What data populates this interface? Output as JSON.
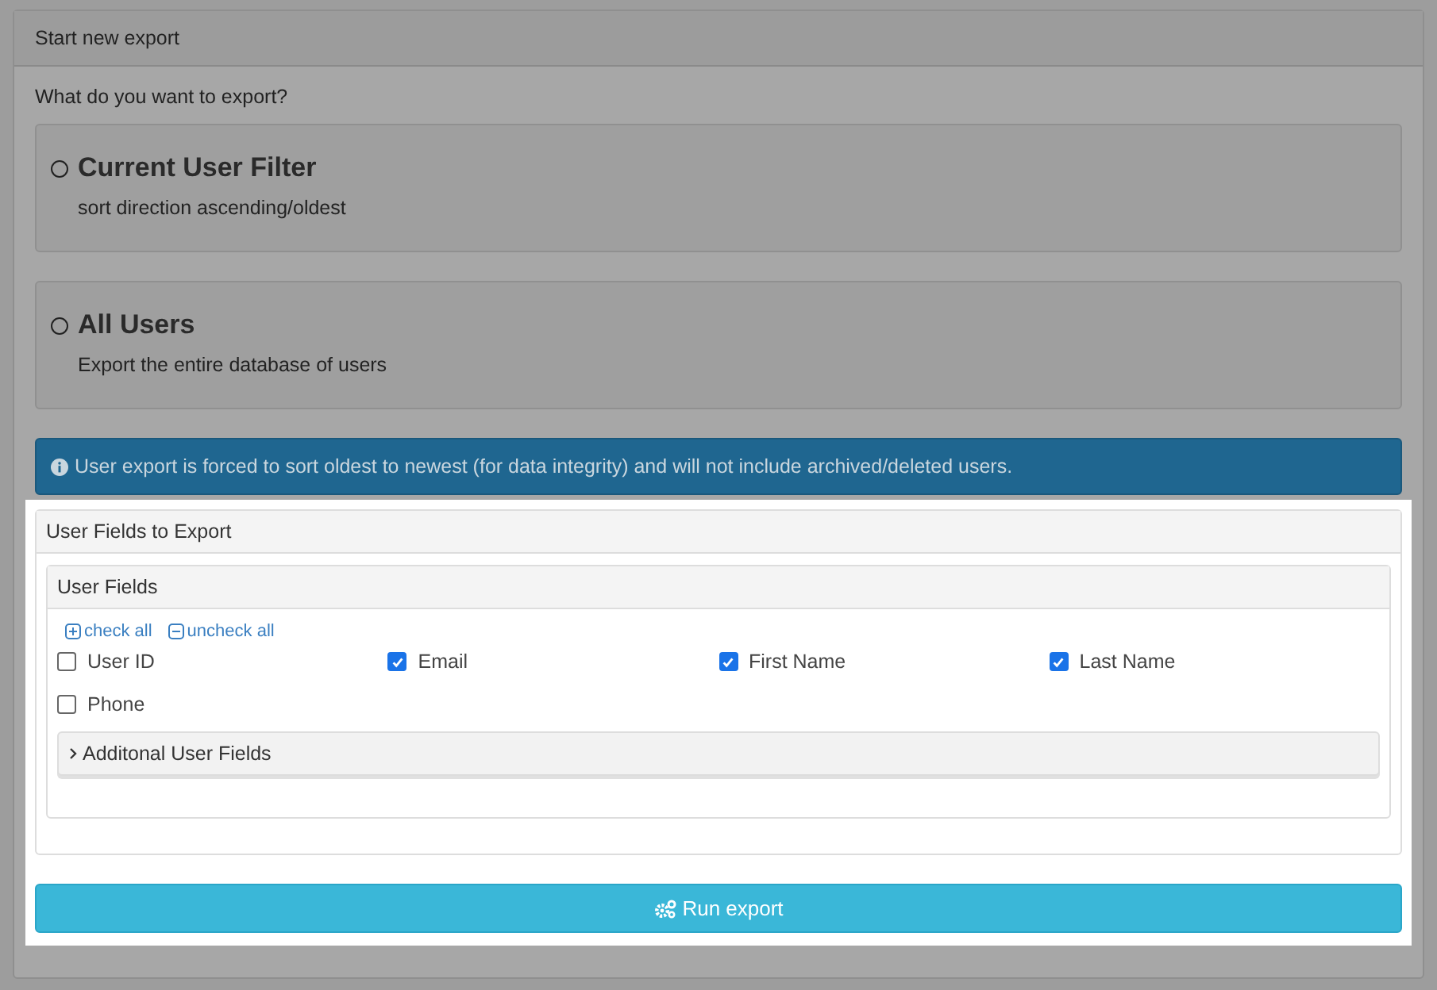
{
  "panel": {
    "title": "Start new export"
  },
  "question": "What do you want to export?",
  "options": [
    {
      "title": "Current User Filter",
      "description": "sort direction ascending/oldest",
      "selected": false
    },
    {
      "title": "All Users",
      "description": "Export the entire database of users",
      "selected": false
    }
  ],
  "notice": "User export is forced to sort oldest to newest (for data integrity) and will not include archived/deleted users.",
  "fields_panel": {
    "title": "User Fields to Export",
    "group": {
      "title": "User Fields",
      "check_all": "check all",
      "uncheck_all": "uncheck all",
      "fields": [
        {
          "label": "User ID",
          "checked": false
        },
        {
          "label": "Email",
          "checked": true
        },
        {
          "label": "First Name",
          "checked": true
        },
        {
          "label": "Last Name",
          "checked": true
        },
        {
          "label": "Phone",
          "checked": false
        }
      ],
      "additional": {
        "label": "Additonal User Fields",
        "expanded": false
      }
    }
  },
  "run_button": "Run export"
}
